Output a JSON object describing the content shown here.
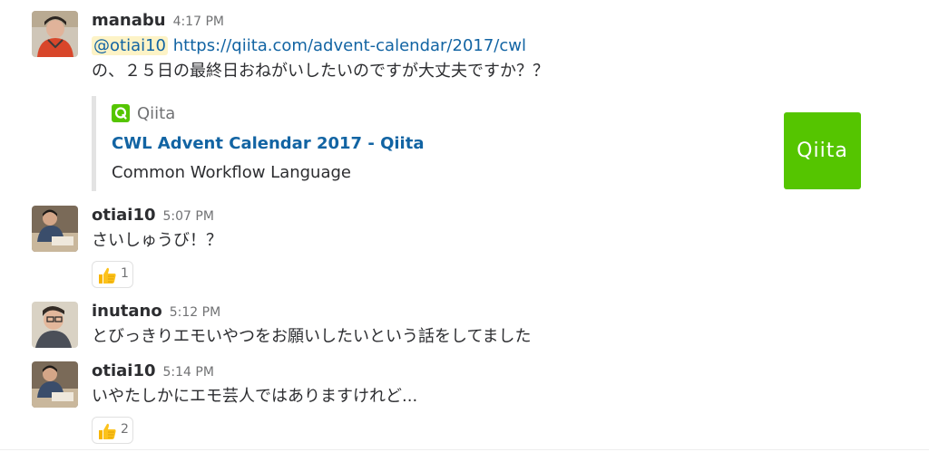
{
  "messages": [
    {
      "username": "manabu",
      "time": "4:17 PM",
      "mention": "@otiai10",
      "link": "https://qiita.com/advent-calendar/2017/cwl",
      "text": "の、２５日の最終日おねがいしたいのですが大丈夫ですか？？",
      "attachment": {
        "service_name": "Qiita",
        "title": "CWL Advent Calendar 2017 - Qiita",
        "description": "Common Workflow Language",
        "thumb_text": "Qiita",
        "thumb_color": "#55c500"
      }
    },
    {
      "username": "otiai10",
      "time": "5:07 PM",
      "text": "さいしゅうび！？",
      "reaction": {
        "emoji": "thumbs-up-icon",
        "count": "1"
      }
    },
    {
      "username": "inutano",
      "time": "5:12 PM",
      "text": "とびっきりエモいやつをお願いしたいという話をしてました"
    },
    {
      "username": "otiai10",
      "time": "5:14 PM",
      "text": "いやたしかにエモ芸人ではありますけれど...",
      "reaction": {
        "emoji": "thumbs-up-icon",
        "count": "2"
      }
    }
  ],
  "colors": {
    "link": "#1264a3",
    "mention_bg": "#fdf3c6",
    "qiita_green": "#55c500"
  }
}
